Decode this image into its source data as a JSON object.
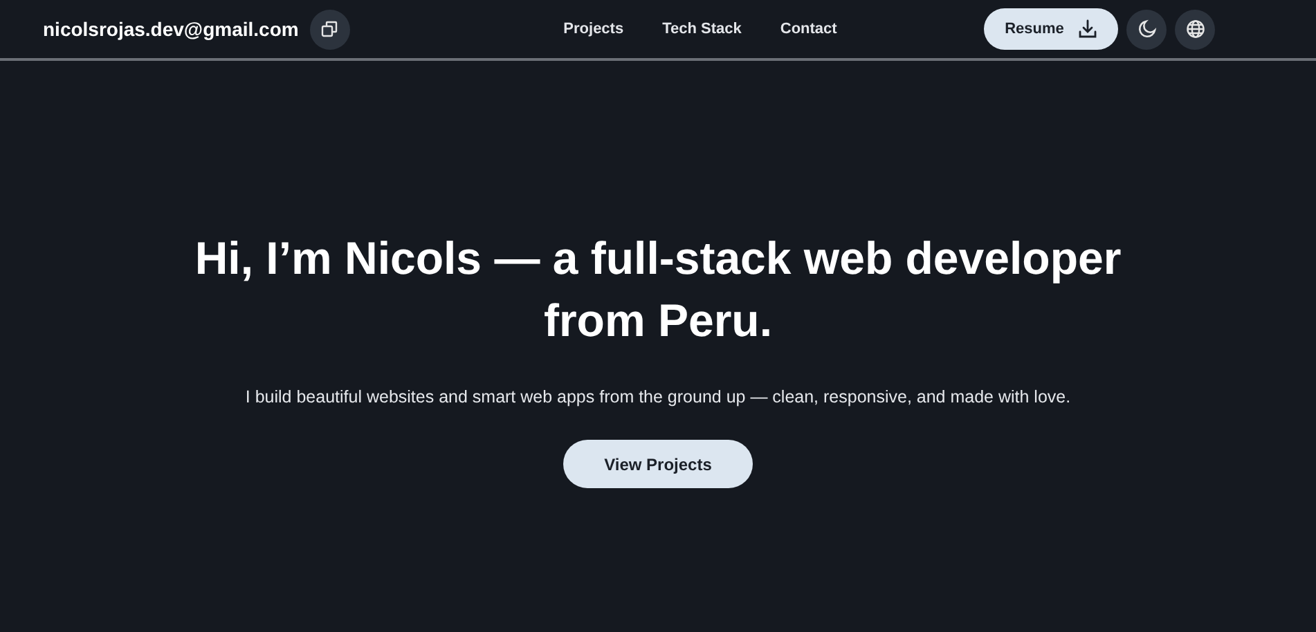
{
  "header": {
    "email": "nicolsrojas.dev@gmail.com",
    "nav": [
      {
        "label": "Projects"
      },
      {
        "label": "Tech Stack"
      },
      {
        "label": "Contact"
      }
    ],
    "resume_button": "Resume"
  },
  "hero": {
    "headline": "Hi, I’m Nicols — a full-stack web developer from Peru.",
    "subtitle": "I build beautiful websites and smart web apps from the ground up — clean, responsive, and made with love.",
    "button": "View Projects"
  }
}
